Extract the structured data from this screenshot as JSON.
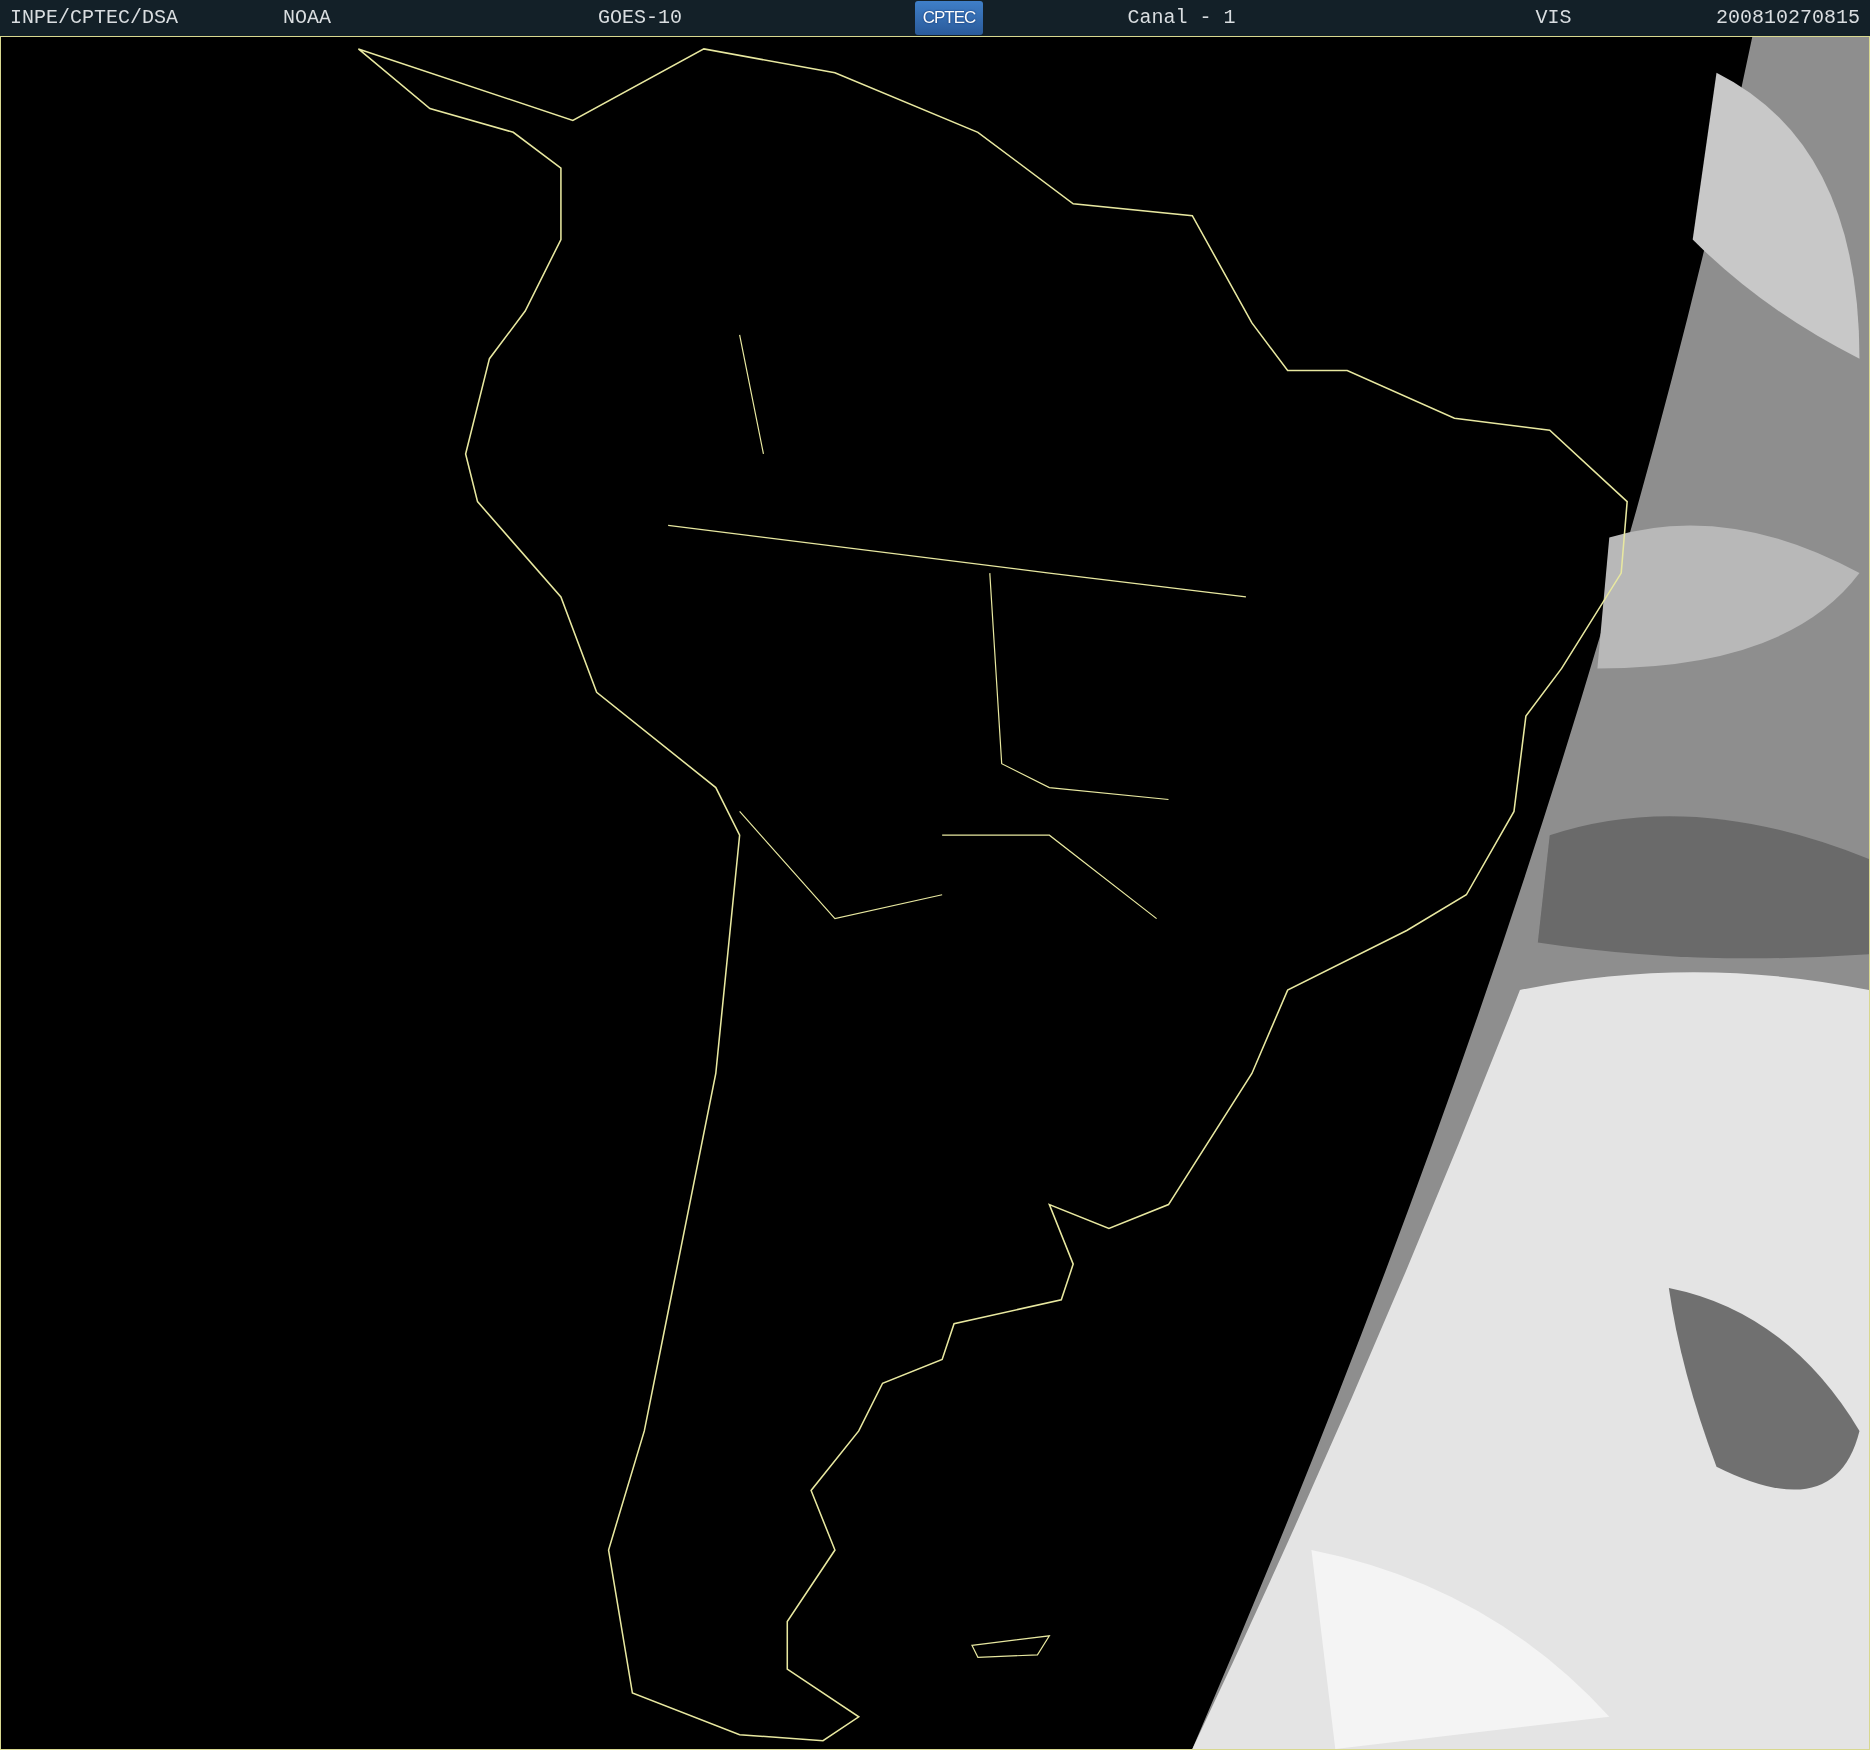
{
  "header": {
    "source": "INPE/CPTEC/DSA",
    "agency": "NOAA",
    "satellite": "GOES-10",
    "logo_text": "CPTEC",
    "channel": "Canal - 1",
    "band": "VIS",
    "timestamp": "200810270815"
  }
}
